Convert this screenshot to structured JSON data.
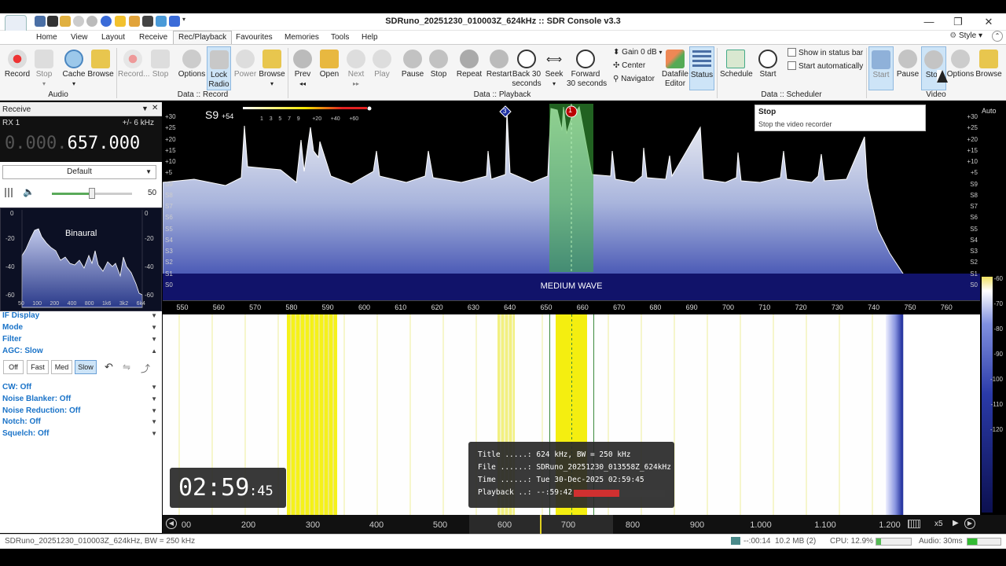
{
  "window": {
    "title": "SDRuno_20251230_010003Z_624kHz :: SDR Console v3.3"
  },
  "menu": {
    "items": [
      "Home",
      "View",
      "Layout",
      "Receive",
      "Rec/Playback",
      "Favourites",
      "Memories",
      "Tools",
      "Help"
    ],
    "active": "Rec/Playback",
    "style": "Style"
  },
  "ribbon": {
    "audio": {
      "record": "Record",
      "stop": "Stop",
      "cache": "Cache",
      "browse": "Browse",
      "group": "Audio"
    },
    "data_record": {
      "record": "Record...",
      "stop": "Stop",
      "options": "Options",
      "lock": "Lock",
      "radio": "Radio",
      "power": "Power",
      "browse": "Browse",
      "group": "Data :: Record"
    },
    "playback": {
      "prev": "Prev",
      "open": "Open",
      "next": "Next",
      "play": "Play",
      "pause": "Pause",
      "stop": "Stop",
      "repeat": "Repeat",
      "restart": "Restart",
      "back1": "Back 30",
      "back2": "seconds",
      "seek": "Seek",
      "fwd1": "Forward",
      "fwd2": "30 seconds",
      "gain": "Gain 0 dB",
      "center": "Center",
      "navigator": "Navigator",
      "datafile1": "Datafile",
      "datafile2": "Editor",
      "status": "Status",
      "group": "Data :: Playback"
    },
    "scheduler": {
      "schedule": "Schedule",
      "start": "Start",
      "show_status": "Show in status bar",
      "start_auto": "Start automatically",
      "group": "Data :: Scheduler"
    },
    "video": {
      "start": "Start",
      "pause": "Pause",
      "stop": "Stop",
      "options": "Options",
      "browse": "Browse",
      "group": "Video"
    }
  },
  "tooltip": {
    "title": "Stop",
    "text": "Stop the video recorder"
  },
  "receive": {
    "header": "Receive",
    "rx": "RX 1",
    "bw": "+/- 6 kHz",
    "freq_dim": "0.000.",
    "freq": "657.000",
    "preset": "Default",
    "volume": "50",
    "volume_level": 0.5,
    "binaural": "Binaural",
    "spec_y_left": [
      "0",
      "-20",
      "-40",
      "-60"
    ],
    "spec_y_right": [
      "0",
      "-20",
      "-40",
      "-60"
    ],
    "spec_x": [
      "50",
      "100",
      "200",
      "400",
      "800",
      "1k6",
      "3k2",
      "6k4"
    ],
    "sections": [
      "IF Display",
      "Mode",
      "Filter",
      "AGC: Slow"
    ],
    "agc": [
      "Off",
      "Fast",
      "Med",
      "Slow"
    ],
    "agc_active": "Slow",
    "sections2": [
      "CW: Off",
      "Noise Blanker: Off",
      "Noise Reduction: Off",
      "Notch: Off",
      "Squelch: Off"
    ]
  },
  "spectrum": {
    "smeter": "S9",
    "smeter_plus": "+54",
    "meter_scale": [
      "1",
      "3",
      "5",
      "7",
      "9",
      "+20",
      "+40",
      "+60"
    ],
    "y_left": [
      "+30",
      "+25",
      "+20",
      "+15",
      "+10",
      "+5",
      "S9",
      "S8",
      "S7",
      "S6",
      "S5",
      "S4",
      "S3",
      "S2",
      "S1",
      "S0"
    ],
    "y_right": [
      "+30",
      "+25",
      "+20",
      "+15",
      "+10",
      "+5",
      "S9",
      "S8",
      "S7",
      "S6",
      "S5",
      "S4",
      "S3",
      "S2",
      "S1",
      "S0"
    ],
    "band_label": "MEDIUM WAVE",
    "marker_1": "1",
    "marker_3": "3",
    "freq_ticks": [
      "550",
      "560",
      "570",
      "580",
      "590",
      "600",
      "610",
      "620",
      "630",
      "640",
      "650",
      "660",
      "670",
      "680",
      "690",
      "700",
      "710",
      "720",
      "730",
      "740",
      "750",
      "760"
    ],
    "auto": "Auto",
    "wf_scale": [
      "-60",
      "-70",
      "-80",
      "-90",
      "-100",
      "-110",
      "-120"
    ]
  },
  "info": {
    "title": "Title .....: 624 kHz, BW = 250 kHz",
    "file": "File ......: SDRuno_20251230_013558Z_624kHz",
    "time": "Time ......: Tue 30-Dec-2025 02:59:45",
    "playback": "Playback ..: --:59:42",
    "progress": 0.5
  },
  "clock": {
    "main": "02:59",
    "sec": ":45"
  },
  "timeline": {
    "labels": [
      "00",
      "200",
      "300",
      "400",
      "500",
      "600",
      "700",
      "800",
      "900",
      "1.000",
      "1.100",
      "1.200"
    ],
    "zoom": "x5"
  },
  "status": {
    "left": "SDRuno_20251230_010003Z_624kHz, BW = 250 kHz",
    "time": "--:00:14",
    "size": "10.2 MB (2)",
    "cpu": "CPU: 12.9%",
    "audio": "Audio: 30ms"
  }
}
